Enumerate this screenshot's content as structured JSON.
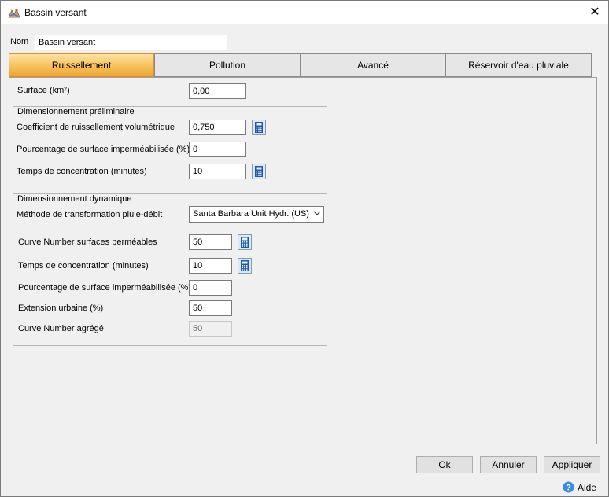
{
  "window": {
    "title": "Bassin versant"
  },
  "name_field": {
    "label": "Nom",
    "value": "Bassin versant"
  },
  "tabs": [
    {
      "label": "Ruissellement"
    },
    {
      "label": "Pollution"
    },
    {
      "label": "Avancé"
    },
    {
      "label": "Réservoir d'eau pluviale"
    }
  ],
  "surface": {
    "label": "Surface (km²)",
    "value": "0,00"
  },
  "prelim": {
    "title": "Dimensionnement préliminaire",
    "runoff_coef": {
      "label": "Coefficient de ruissellement volumétrique",
      "value": "0,750"
    },
    "impervious_pct": {
      "label": "Pourcentage de surface imperméabilisée (%)",
      "value": "0"
    },
    "tc": {
      "label": "Temps de concentration (minutes)",
      "value": "10"
    }
  },
  "dynamic": {
    "title": "Dimensionnement dynamique",
    "method": {
      "label": "Méthode de transformation pluie-débit",
      "value": "Santa Barbara Unit Hydr. (US)"
    },
    "cn_pervious": {
      "label": "Curve Number surfaces perméables",
      "value": "50"
    },
    "tc": {
      "label": "Temps de concentration (minutes)",
      "value": "10"
    },
    "impervious_pct": {
      "label": "Pourcentage de surface imperméabilisée (%)",
      "value": "0"
    },
    "urban_ext": {
      "label": "Extension urbaine (%)",
      "value": "50"
    },
    "cn_aggregate": {
      "label": "Curve Number agrégé",
      "value": "50"
    }
  },
  "buttons": {
    "ok": "Ok",
    "cancel": "Annuler",
    "apply": "Appliquer",
    "help": "Aide"
  },
  "colors": {
    "active_tab": "#f7c15a",
    "calc_icon": "#1e5aa8",
    "help_icon": "#3a8dde"
  }
}
